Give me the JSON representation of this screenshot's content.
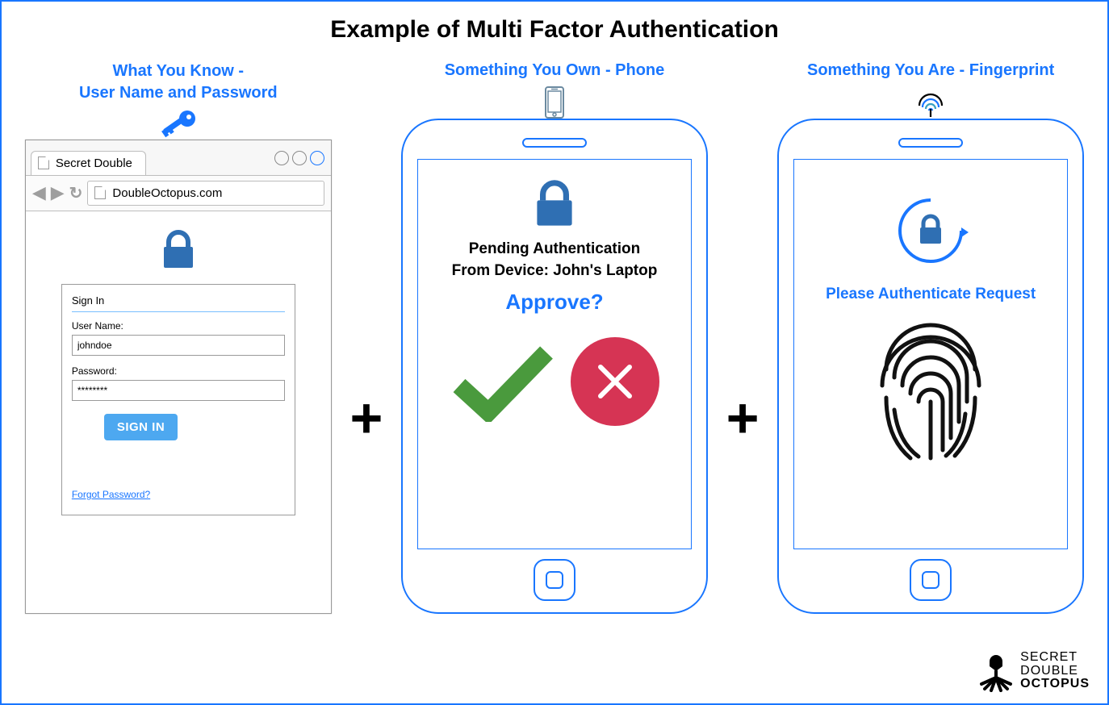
{
  "title": "Example of Multi Factor Authentication",
  "factor1": {
    "heading_line1": "What You Know -",
    "heading_line2": "User Name and Password",
    "browser": {
      "tab_title": "Secret Double",
      "url": "DoubleOctopus.com",
      "card_title": "Sign In",
      "username_label": "User Name:",
      "username_value": "johndoe",
      "password_label": "Password:",
      "password_value": "********",
      "signin_button": "SIGN IN",
      "forgot_link": "Forgot Password?"
    }
  },
  "factor2": {
    "heading": "Something You Own - Phone",
    "pending_line1": "Pending Authentication",
    "pending_line2": "From Device: John's Laptop",
    "approve_question": "Approve?"
  },
  "factor3": {
    "heading": "Something You Are - Fingerprint",
    "request_text": "Please Authenticate Request"
  },
  "brand": {
    "line1": "SECRET",
    "line2": "DOUBLE",
    "line3": "OCTOPUS"
  },
  "plus_symbol": "+"
}
